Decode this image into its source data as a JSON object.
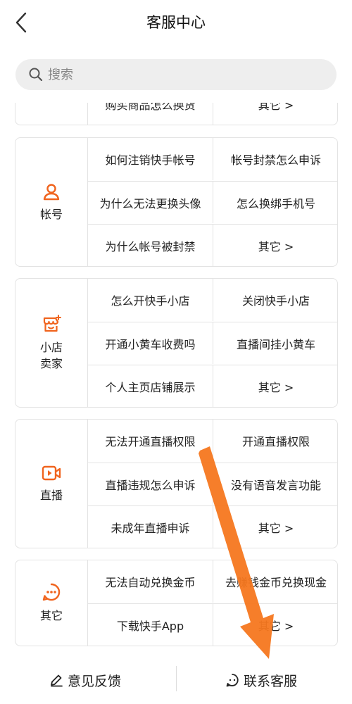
{
  "header": {
    "title": "客服中心",
    "back_icon": "chevron-left-icon"
  },
  "search": {
    "placeholder": "搜索",
    "icon": "search-icon"
  },
  "accent_color": "#f0641e",
  "partial_card": {
    "left": "购买商品怎么换货",
    "right": "其它 >"
  },
  "cards": [
    {
      "icon": "user-icon",
      "label": "帐号",
      "items": [
        "如何注销快手帐号",
        "帐号封禁怎么申诉",
        "为什么无法更换头像",
        "怎么换绑手机号",
        "为什么帐号被封禁",
        "其它 >"
      ]
    },
    {
      "icon": "shop-icon",
      "label": "小店卖家",
      "items": [
        "怎么开快手小店",
        "关闭快手小店",
        "开通小黄车收费吗",
        "直播间挂小黄车",
        "个人主页店铺展示",
        "其它 >"
      ]
    },
    {
      "icon": "live-video-icon",
      "label": "直播",
      "items": [
        "无法开通直播权限",
        "开通直播权限",
        "直播违规怎么申诉",
        "没有语音发言功能",
        "未成年直播申诉",
        "其它 >"
      ]
    },
    {
      "icon": "more-icon",
      "label": "其它",
      "items": [
        "无法自动兑换金币",
        "去赚钱金币兑换现金",
        "下载快手App",
        "其它 >"
      ]
    }
  ],
  "footer": {
    "feedback_label": "意见反馈",
    "feedback_icon": "edit-icon",
    "contact_label": "联系客服",
    "contact_icon": "chat-icon"
  },
  "overlay": {
    "arrow_color": "#f5771f",
    "arrow_icon": "down-arrow-annotation"
  }
}
